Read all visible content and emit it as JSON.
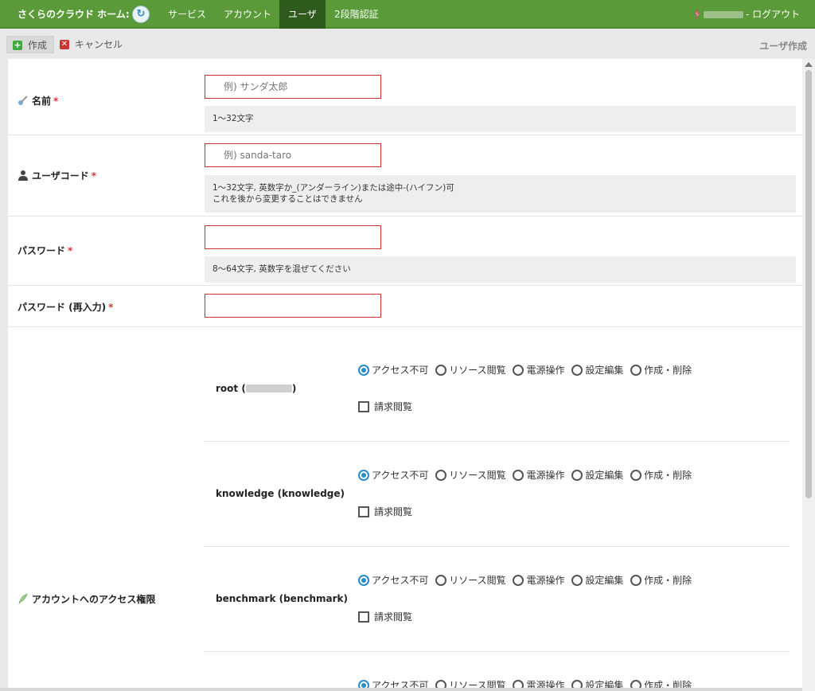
{
  "topnav": {
    "brand": "さくらのクラウド ホーム:",
    "items": [
      "サービス",
      "アカウント",
      "ユーザ",
      "2段階認証"
    ],
    "logout": "- ログアウト"
  },
  "toolbar": {
    "create_label": "作成",
    "cancel_label": "キャンセル",
    "page_title": "ユーザ作成"
  },
  "form": {
    "name": {
      "label": "名前",
      "required": "*",
      "placeholder": "例) サンダ太郎",
      "help": "1〜32文字"
    },
    "user_code": {
      "label": "ユーザコード",
      "required": "*",
      "placeholder": "例) sanda-taro",
      "help_line1": "1〜32文字, 英数字か_(アンダーライン)または途中-(ハイフン)可",
      "help_line2": "これを後から変更することはできません"
    },
    "password": {
      "label": "パスワード",
      "required": "*",
      "help": "8〜64文字, 英数字を混ぜてください"
    },
    "password_confirm": {
      "label": "パスワード (再入力)",
      "required": "*"
    }
  },
  "permissions": {
    "label": "アカウントへのアクセス権限",
    "options": [
      "アクセス不可",
      "リソース閲覧",
      "電源操作",
      "設定編集",
      "作成・削除"
    ],
    "billing_label": "請求閲覧",
    "accounts": [
      {
        "name_prefix": "root (",
        "name_suffix": ")"
      },
      {
        "name": "knowledge (knowledge)"
      },
      {
        "name": "benchmark (benchmark)"
      }
    ]
  },
  "colors": {
    "nav_bg": "#5a9a38",
    "nav_active": "#2f5a1e",
    "accent": "#2a8bc9",
    "required": "#dd3333"
  }
}
